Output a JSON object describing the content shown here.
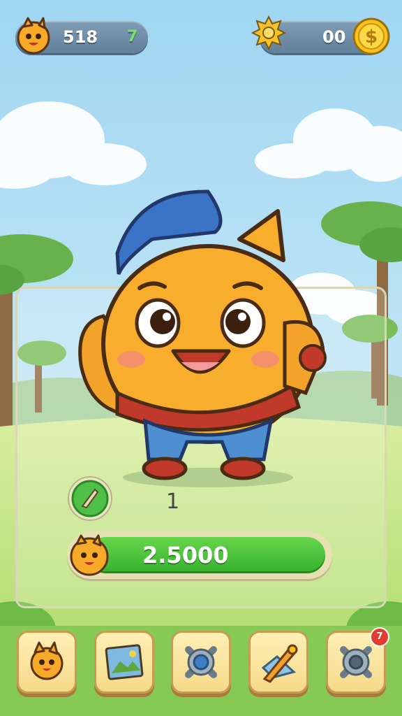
{
  "hud": {
    "player_value": "518",
    "player_badge": "7",
    "currency_value": "00",
    "icons": [
      "cat-avatar-icon",
      "sun-gear-icon",
      "coin-icon"
    ]
  },
  "character": {
    "name_icon": "orange-cat-mascot"
  },
  "panel": {
    "level_value": "1",
    "progress_text": "2.5000",
    "skill_icon": "leaf-arrow-icon",
    "colors": {
      "bar": "#3dbb32",
      "accent": "#f7a928"
    }
  },
  "nav": {
    "items": [
      {
        "icon": "cat-icon"
      },
      {
        "icon": "map-icon"
      },
      {
        "icon": "gear-icon"
      },
      {
        "icon": "pen-icon"
      },
      {
        "icon": "settings-icon",
        "badge": "7"
      }
    ]
  }
}
